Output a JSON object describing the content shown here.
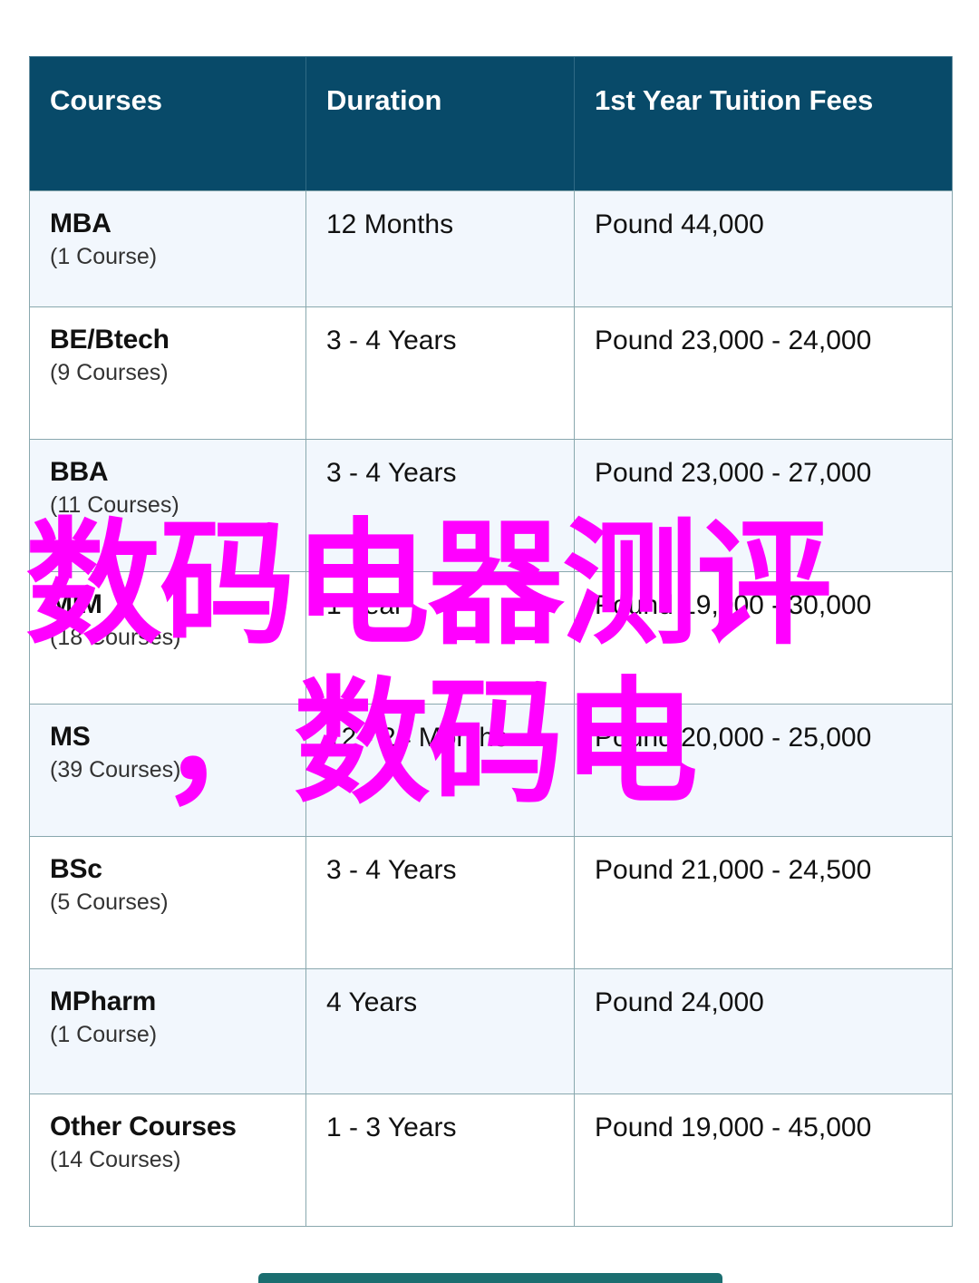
{
  "table": {
    "name": "courses-fees-table",
    "headers": {
      "courses": "Courses",
      "duration": "Duration",
      "fees": "1st Year Tuition Fees"
    },
    "rows": [
      {
        "course": "MBA",
        "count": "(1 Course)",
        "duration": "12 Months",
        "fees": "Pound 44,000"
      },
      {
        "course": "BE/Btech",
        "count": "(9 Courses)",
        "duration": "3 - 4 Years",
        "fees": "Pound 23,000 - 24,000"
      },
      {
        "course": "BBA",
        "count": "(11 Courses)",
        "duration": "3 - 4 Years",
        "fees": "Pound 23,000 - 27,000"
      },
      {
        "course": "MIM",
        "count": "(18 Courses)",
        "duration": "1 Year",
        "fees": "Pound 19,000 - 30,000"
      },
      {
        "course": "MS",
        "count": "(39 Courses)",
        "duration": "12 - 24 Months",
        "fees": "Pound 20,000 - 25,000"
      },
      {
        "course": "BSc",
        "count": "(5 Courses)",
        "duration": "3 - 4 Years",
        "fees": "Pound 21,000 - 24,500"
      },
      {
        "course": "MPharm",
        "count": "(1 Course)",
        "duration": "4 Years",
        "fees": "Pound 24,000"
      },
      {
        "course": "Other Courses",
        "count": "(14 Courses)",
        "duration": "1 - 3 Years",
        "fees": "Pound 19,000 - 45,000"
      }
    ]
  },
  "watermark": {
    "line1": "数码电器测评",
    "line2": "，数码电",
    "color": "#ff00ff"
  },
  "bottom_bar": {
    "color": "#1b6e70"
  },
  "colors": {
    "header_background": "#084a69",
    "header_text": "#ffffff",
    "row_alt_background": "#f2f7fd",
    "row_plain_background": "#ffffff",
    "border": "#89a8ae",
    "body_text": "#111111"
  }
}
